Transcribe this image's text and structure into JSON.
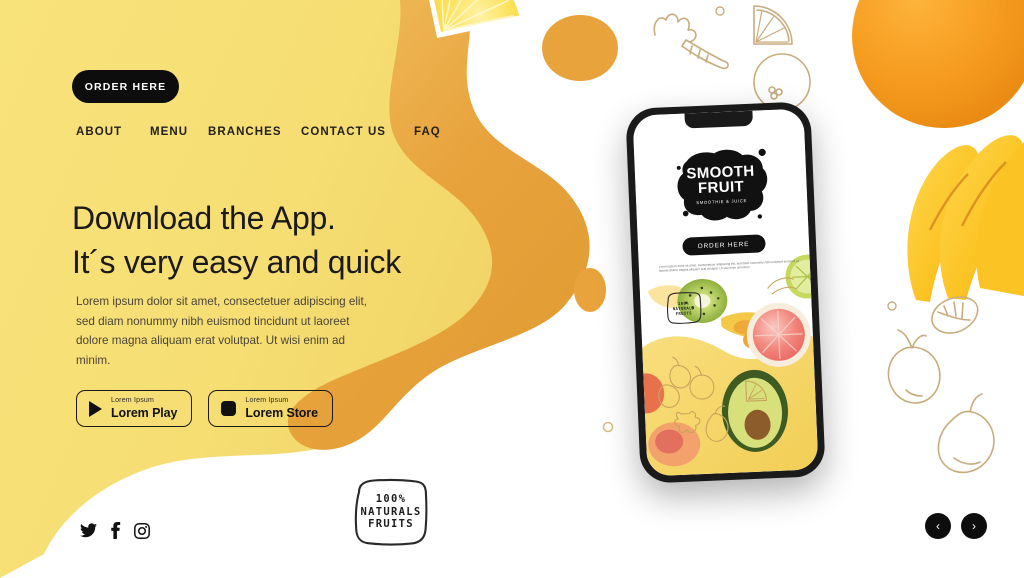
{
  "theme": {
    "bg_yellow": "#F7E074",
    "blob_orange": "#E8A33D",
    "white": "#FFFFFF",
    "ink": "#1A1A1A",
    "doodle_tan": "#C9AC7E",
    "orange_fruit": "#F59A1E"
  },
  "header": {
    "order_button": "ORDER HERE",
    "nav": [
      {
        "label": "ABOUT"
      },
      {
        "label": "MENU"
      },
      {
        "label": "BRANCHES"
      },
      {
        "label": "CONTACT US"
      },
      {
        "label": "FAQ"
      }
    ]
  },
  "hero": {
    "headline_line1": "Download the App.",
    "headline_line2": "It´s very easy and quick",
    "paragraph": "Lorem ipsum dolor sit amet, consectetuer adipiscing elit, sed diam nonummy nibh euismod tincidunt ut laoreet dolore magna aliquam erat volutpat. Ut wisi enim ad minim.",
    "stores": [
      {
        "small": "Lorem Ipsum",
        "big": "Lorem Play",
        "icon": "play-triangle-icon"
      },
      {
        "small": "Lorem Ipsum",
        "big": "Lorem Store",
        "icon": "apple-square-icon"
      }
    ]
  },
  "social": [
    {
      "name": "twitter-icon"
    },
    {
      "name": "facebook-icon"
    },
    {
      "name": "instagram-icon"
    }
  ],
  "badge": {
    "line1": "100%",
    "line2": "NATURALS",
    "line3": "FRUITS"
  },
  "carousel": {
    "prev": "‹",
    "next": "›"
  },
  "phone": {
    "logo_line1": "SMOOTH",
    "logo_line2": "FRUIT",
    "logo_tagline": "SMOOTHIE & JUICE",
    "order_button": "ORDER HERE",
    "paragraph": "Lorem ipsum dolor sit amet, consectetuer adipiscing elit, sed diam nonummy nibh euismod tincidunt ut laoreet dolore magna aliquam erat volutpat. Ut wisi enim ad minim.",
    "badge_line1": "100%",
    "badge_line2": "NATURALS",
    "badge_line3": "FRUITS"
  }
}
